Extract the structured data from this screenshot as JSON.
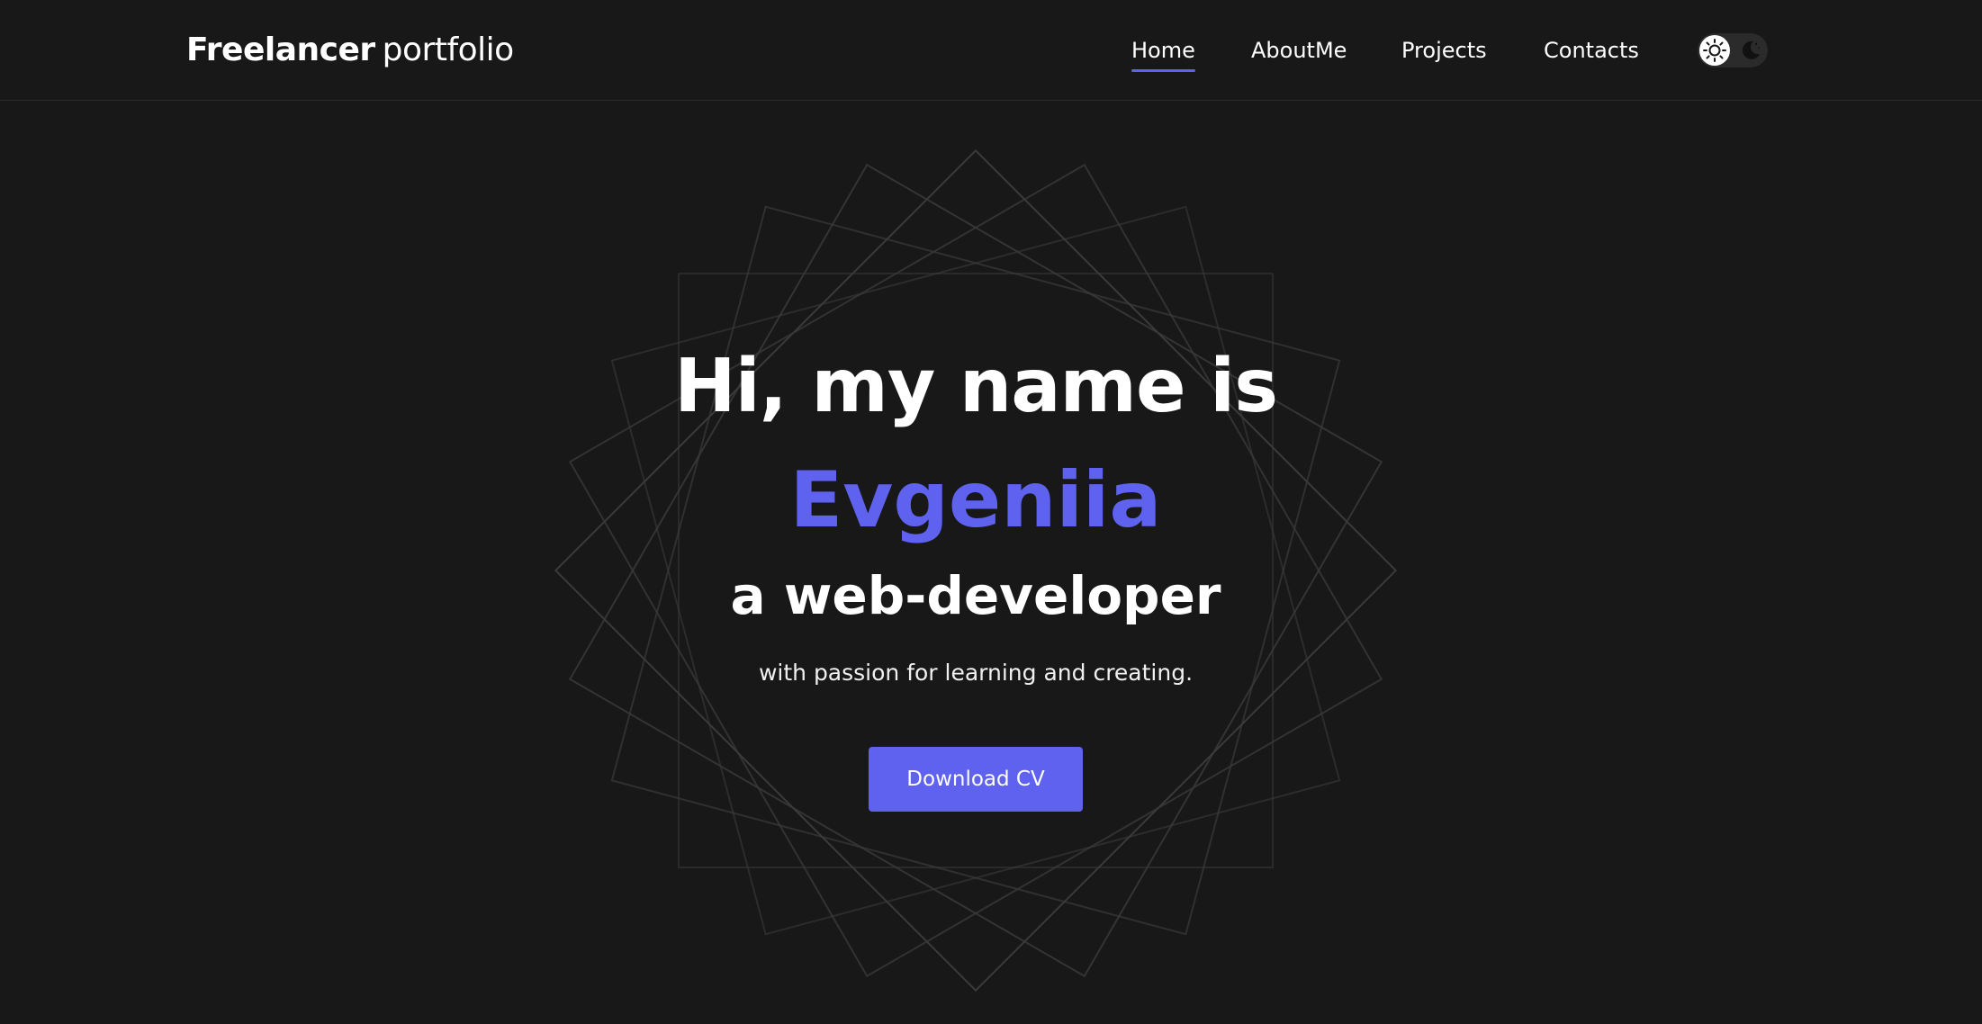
{
  "brand": {
    "bold": "Freelancer",
    "light": "portfolio"
  },
  "nav": {
    "items": [
      {
        "label": "Home",
        "active": true
      },
      {
        "label": "AboutMe",
        "active": false
      },
      {
        "label": "Projects",
        "active": false
      },
      {
        "label": "Contacts",
        "active": false
      }
    ]
  },
  "theme_toggle": {
    "mode": "dark",
    "light_icon": "sun-icon",
    "dark_icon": "moon-icon"
  },
  "hero": {
    "greeting": "Hi, my name is",
    "name": "Evgeniia",
    "role": "a web-developer",
    "tagline": "with passion for learning and creating.",
    "cta_label": "Download CV"
  },
  "colors": {
    "background": "#181818",
    "accent": "#5f62ee",
    "text": "#ffffff",
    "toggle_track": "#2b2b2b"
  }
}
